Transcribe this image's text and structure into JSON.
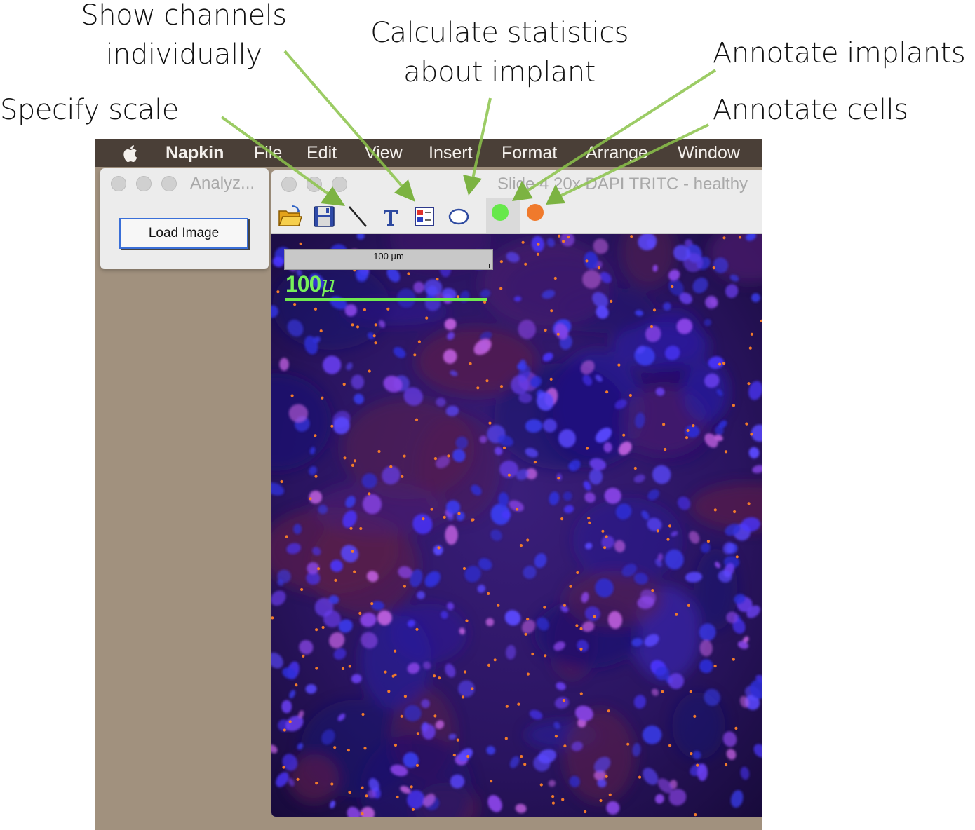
{
  "callouts": {
    "show_channels": [
      "Show channels",
      "individually"
    ],
    "calculate_stats": [
      "Calculate statistics",
      "about implant"
    ],
    "annotate_implants": "Annotate implants",
    "specify_scale": "Specify scale",
    "annotate_cells": "Annotate cells"
  },
  "menubar": {
    "app_name": "Napkin",
    "items": [
      "File",
      "Edit",
      "View",
      "Insert",
      "Format",
      "Arrange",
      "Window"
    ]
  },
  "analyze_window": {
    "title": "Analyz...",
    "load_button": "Load Image"
  },
  "image_window": {
    "title": "Slide 4 20x DAPI TRITC - healthy",
    "tools": [
      "open-folder-icon",
      "save-disk-icon",
      "line-icon",
      "text-icon",
      "channels-icon",
      "ellipse-icon",
      "green-dot-icon",
      "orange-dot-icon"
    ],
    "scalebar_label": "100 µm",
    "green_scale_value": "100",
    "green_scale_unit": "μ"
  },
  "colors": {
    "arrow": "#8bc34a",
    "implant_marker": "#66e84a",
    "cell_marker": "#f07a2c",
    "menubar": "#4a3f37",
    "desktop": "#a1917e"
  }
}
